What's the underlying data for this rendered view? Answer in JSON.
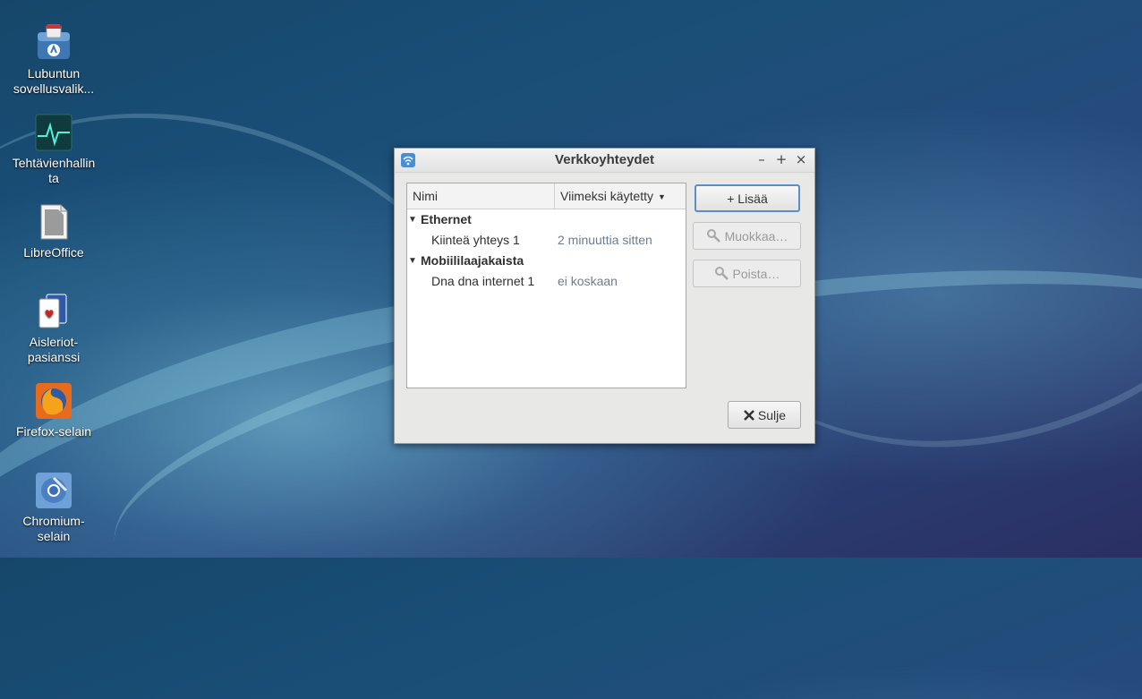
{
  "desktop": {
    "icons": [
      {
        "label": "Lubuntun\nsovellusvalik...",
        "icon": "software-center-icon"
      },
      {
        "label": "Tehtävienhallin\nta",
        "icon": "task-manager-icon"
      },
      {
        "label": "LibreOffice",
        "icon": "libreoffice-icon"
      },
      {
        "label": "Aisleriot-\npasianssi",
        "icon": "cards-icon"
      },
      {
        "label": "Firefox-selain",
        "icon": "firefox-icon"
      },
      {
        "label": "Chromium-\nselain",
        "icon": "chromium-icon"
      }
    ]
  },
  "window": {
    "title": "Verkkoyhteydet",
    "controls": {
      "minimize": "–",
      "maximize": "+",
      "close": "×"
    },
    "list": {
      "columns": {
        "name": "Nimi",
        "last_used": "Viimeksi käytetty"
      },
      "groups": [
        {
          "name": "Ethernet",
          "expanded": true,
          "connections": [
            {
              "name": "Kiinteä yhteys 1",
              "last_used": "2 minuuttia sitten"
            }
          ]
        },
        {
          "name": "Mobiililaajakaista",
          "expanded": true,
          "connections": [
            {
              "name": "Dna dna internet 1",
              "last_used": "ei koskaan"
            }
          ]
        }
      ]
    },
    "buttons": {
      "add": "+ Lisää",
      "edit": "Muokkaa…",
      "delete": "Poista…",
      "close": "Sulje"
    }
  },
  "colors": {
    "accent": "#5a8ec5",
    "secondary_text": "#6b7d8e"
  }
}
